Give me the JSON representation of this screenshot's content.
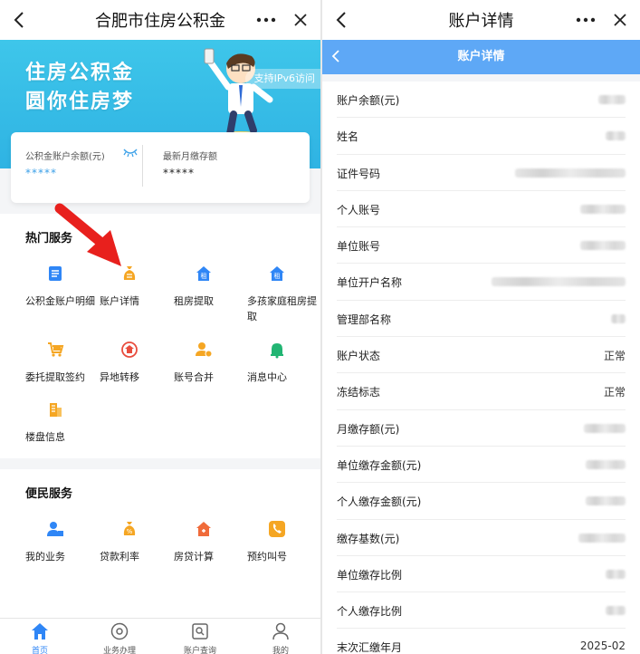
{
  "left": {
    "title": "合肥市住房公积金",
    "banner": {
      "line1": "住房公积金",
      "line2": "圆你住房梦",
      "ipv6": "支持IPv6访问"
    },
    "card": {
      "balance_label": "公积金账户余额(元)",
      "balance_value": "*****",
      "monthly_label": "最新月缴存额",
      "monthly_value": "*****"
    },
    "hot_title": "热门服务",
    "hot_services": [
      {
        "label": "公积金账户明细",
        "icon": "document-list-icon"
      },
      {
        "label": "账户详情",
        "icon": "money-bag-icon"
      },
      {
        "label": "租房提取",
        "icon": "rent-house-icon"
      },
      {
        "label": "多孩家庭租房提取",
        "icon": "rent-house-icon"
      },
      {
        "label": "委托提取签约",
        "icon": "cart-sign-icon"
      },
      {
        "label": "异地转移",
        "icon": "transfer-house-icon"
      },
      {
        "label": "账号合并",
        "icon": "user-merge-icon"
      },
      {
        "label": "消息中心",
        "icon": "bell-icon"
      },
      {
        "label": "楼盘信息",
        "icon": "building-icon"
      }
    ],
    "conv_title": "便民服务",
    "conv_services": [
      {
        "label": "我的业务",
        "icon": "user-business-icon"
      },
      {
        "label": "贷款利率",
        "icon": "money-bag-icon"
      },
      {
        "label": "房贷计算",
        "icon": "house-calc-icon"
      },
      {
        "label": "预约叫号",
        "icon": "phone-icon"
      }
    ],
    "tabs": [
      {
        "label": "首页",
        "icon": "home-icon",
        "active": true
      },
      {
        "label": "业务办理",
        "icon": "circle-icon",
        "active": false
      },
      {
        "label": "账户查询",
        "icon": "query-icon",
        "active": false
      },
      {
        "label": "我的",
        "icon": "user-icon",
        "active": false
      }
    ],
    "colors": {
      "accent": "#2f86f6",
      "banner": "#3ec6ea",
      "arrow": "#e8201d"
    }
  },
  "right": {
    "title": "账户详情",
    "subtitle": "账户详情",
    "rows": [
      {
        "label": "账户余额(元)",
        "value": ""
      },
      {
        "label": "姓名",
        "value": ""
      },
      {
        "label": "证件号码",
        "value": ""
      },
      {
        "label": "个人账号",
        "value": ""
      },
      {
        "label": "单位账号",
        "value": ""
      },
      {
        "label": "单位开户名称",
        "value": ""
      },
      {
        "label": "管理部名称",
        "value": ""
      },
      {
        "label": "账户状态",
        "value": "正常"
      },
      {
        "label": "冻结标志",
        "value": "正常"
      },
      {
        "label": "月缴存额(元)",
        "value": ""
      },
      {
        "label": "单位缴存金额(元)",
        "value": ""
      },
      {
        "label": "个人缴存金额(元)",
        "value": ""
      },
      {
        "label": "缴存基数(元)",
        "value": ""
      },
      {
        "label": "单位缴存比例",
        "value": ""
      },
      {
        "label": "个人缴存比例",
        "value": ""
      },
      {
        "label": "末次汇缴年月",
        "value": "2025-02"
      }
    ],
    "colors": {
      "bluebar": "#5ea8f6"
    }
  }
}
